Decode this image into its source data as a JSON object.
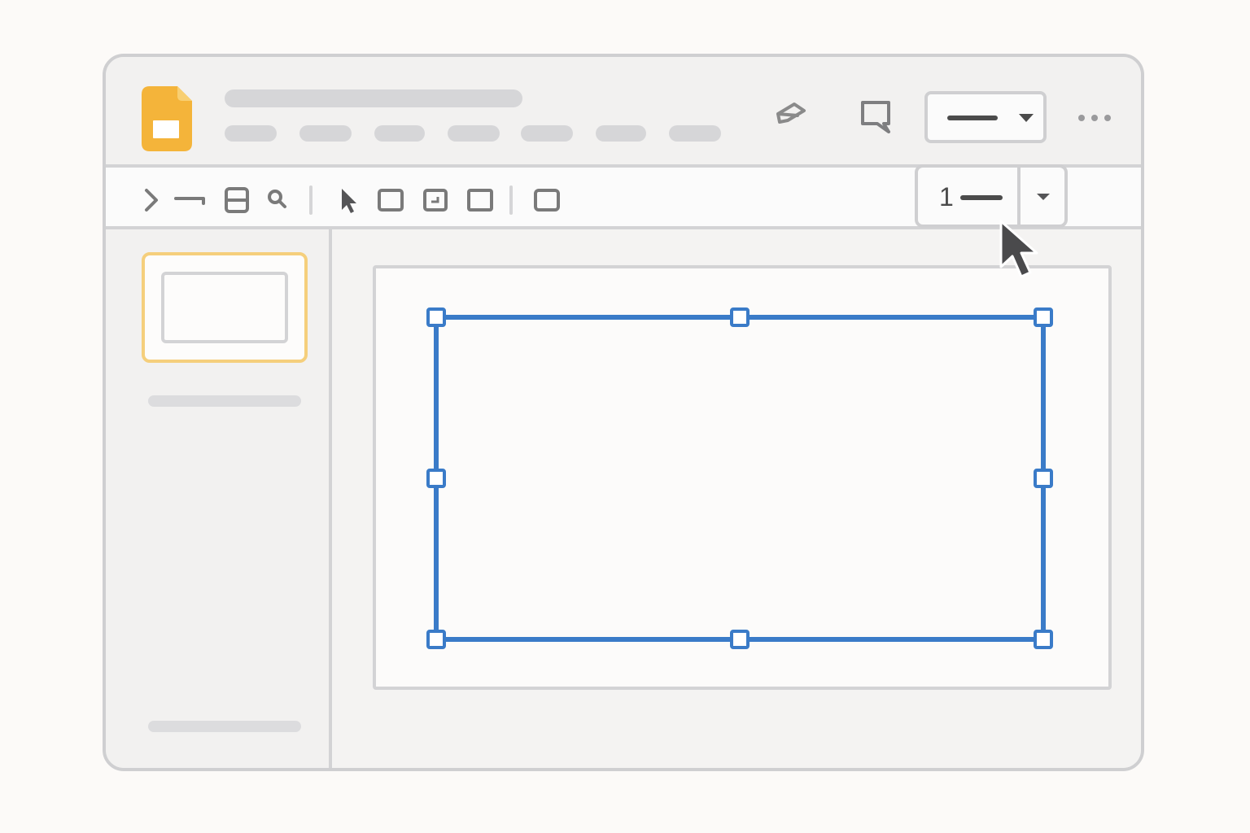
{
  "colors": {
    "brand": "#f4b43a",
    "selection": "#3a7bc8",
    "thumbnail_highlight": "#f5cf7c",
    "border": "#cfcfd1",
    "icon": "#777777"
  },
  "header": {
    "logo_icon": "slides-doc-icon",
    "pen_icon": "pen-icon",
    "comment_icon": "comment-icon",
    "line_style_dropdown_icon": "chevron-down-icon",
    "more_icon": "more-horizontal-icon"
  },
  "toolbar": {
    "icons": [
      "chevron-right-icon",
      "line-icon",
      "layout-icon",
      "zoom-icon",
      "pointer-icon",
      "rectangle-icon",
      "image-icon",
      "shape-icon",
      "textbox-icon"
    ],
    "border_weight": {
      "value": "1",
      "dropdown_icon": "chevron-down-icon"
    }
  },
  "sidebar": {
    "slides": [
      {
        "selected": true
      }
    ]
  },
  "canvas": {
    "selected_shape": "rectangle",
    "handles": 8
  }
}
